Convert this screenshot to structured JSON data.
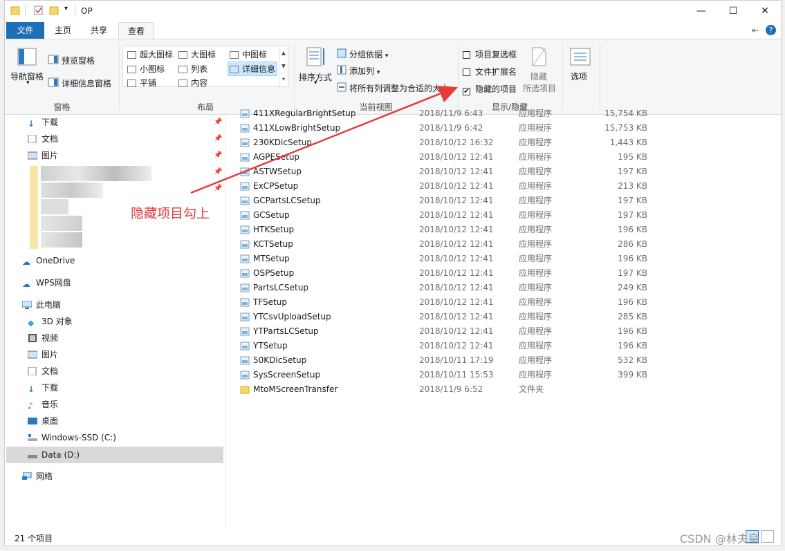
{
  "titlebar": {
    "title": "OP",
    "minimize": "—",
    "maximize": "☐",
    "close": "✕"
  },
  "tabs": [
    {
      "label": "文件"
    },
    {
      "label": "主页"
    },
    {
      "label": "共享"
    },
    {
      "label": "查看"
    }
  ],
  "ribbon": {
    "panes": {
      "nav_pane": "导航窗格",
      "preview": "预览窗格",
      "details": "详细信息窗格",
      "group": "窗格"
    },
    "layout": {
      "items": [
        "超大图标",
        "大图标",
        "中图标",
        "小图标",
        "列表",
        "详细信息",
        "平铺",
        "内容"
      ],
      "selected": "详细信息",
      "group": "布局"
    },
    "current_view": {
      "sort": "排序方式",
      "group_by": "分组依据",
      "add_col": "添加列",
      "fit": "将所有列调整为合适的大小",
      "group": "当前视图"
    },
    "show_hide": {
      "checkbox_items": "项目复选框",
      "file_ext": "文件扩展名",
      "hidden_items": "隐藏的项目",
      "hidden_items_checked": true,
      "hide": "隐藏",
      "selected_items": "所选项目",
      "group": "显示/隐藏"
    },
    "options": "选项"
  },
  "nav": {
    "quick": [
      "下载",
      "文档",
      "图片"
    ],
    "onedrive": "OneDrive",
    "wps": "WPS网盘",
    "pc": "此电脑",
    "pc_items": [
      "3D 对象",
      "视频",
      "图片",
      "文档",
      "下载",
      "音乐",
      "桌面",
      "Windows-SSD (C:)",
      "Data (D:)"
    ],
    "network": "网络"
  },
  "files": [
    {
      "name": "411XRegularBrightSetup",
      "date": "2018/11/9 6:43",
      "type": "应用程序",
      "size": "15,754 KB"
    },
    {
      "name": "411XLowBrightSetup",
      "date": "2018/11/9 6:42",
      "type": "应用程序",
      "size": "15,753 KB"
    },
    {
      "name": "230KDicSetup",
      "date": "2018/10/12 16:32",
      "type": "应用程序",
      "size": "1,443 KB"
    },
    {
      "name": "AGPESetup",
      "date": "2018/10/12 12:41",
      "type": "应用程序",
      "size": "195 KB"
    },
    {
      "name": "ASTWSetup",
      "date": "2018/10/12 12:41",
      "type": "应用程序",
      "size": "197 KB"
    },
    {
      "name": "ExCPSetup",
      "date": "2018/10/12 12:41",
      "type": "应用程序",
      "size": "213 KB"
    },
    {
      "name": "GCPartsLCSetup",
      "date": "2018/10/12 12:41",
      "type": "应用程序",
      "size": "197 KB"
    },
    {
      "name": "GCSetup",
      "date": "2018/10/12 12:41",
      "type": "应用程序",
      "size": "197 KB"
    },
    {
      "name": "HTKSetup",
      "date": "2018/10/12 12:41",
      "type": "应用程序",
      "size": "196 KB"
    },
    {
      "name": "KCTSetup",
      "date": "2018/10/12 12:41",
      "type": "应用程序",
      "size": "286 KB"
    },
    {
      "name": "MTSetup",
      "date": "2018/10/12 12:41",
      "type": "应用程序",
      "size": "196 KB"
    },
    {
      "name": "OSPSetup",
      "date": "2018/10/12 12:41",
      "type": "应用程序",
      "size": "197 KB"
    },
    {
      "name": "PartsLCSetup",
      "date": "2018/10/12 12:41",
      "type": "应用程序",
      "size": "249 KB"
    },
    {
      "name": "TFSetup",
      "date": "2018/10/12 12:41",
      "type": "应用程序",
      "size": "196 KB"
    },
    {
      "name": "YTCsvUploadSetup",
      "date": "2018/10/12 12:41",
      "type": "应用程序",
      "size": "285 KB"
    },
    {
      "name": "YTPartsLCSetup",
      "date": "2018/10/12 12:41",
      "type": "应用程序",
      "size": "196 KB"
    },
    {
      "name": "YTSetup",
      "date": "2018/10/12 12:41",
      "type": "应用程序",
      "size": "196 KB"
    },
    {
      "name": "50KDicSetup",
      "date": "2018/10/11 17:19",
      "type": "应用程序",
      "size": "532 KB"
    },
    {
      "name": "SysScreenSetup",
      "date": "2018/10/11 15:53",
      "type": "应用程序",
      "size": "399 KB"
    },
    {
      "name": "MtoMScreenTransfer",
      "date": "2018/11/9 6:52",
      "type": "文件夹",
      "size": ""
    }
  ],
  "status": "21 个项目",
  "annotation": "隐藏项目勾上",
  "watermark": "CSDN @林夫皇",
  "colors": {
    "accent": "#1e6fb8",
    "annotation": "#e53b3b"
  }
}
